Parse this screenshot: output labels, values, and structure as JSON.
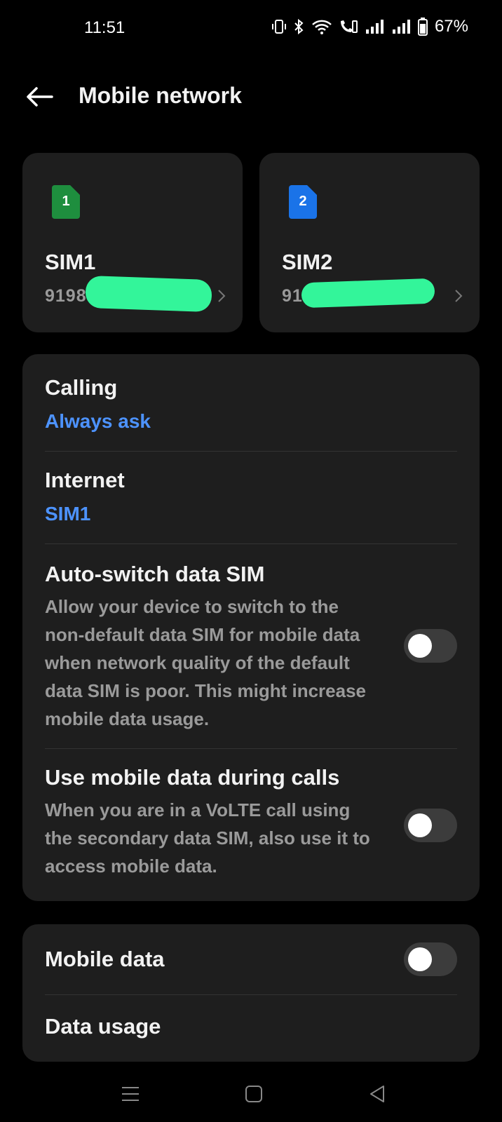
{
  "status_bar": {
    "time": "11:51",
    "battery": "67%"
  },
  "header": {
    "title": "Mobile network"
  },
  "sims": [
    {
      "badge": "1",
      "name": "SIM1",
      "number_visible": "9198",
      "color": "#1e8e3e"
    },
    {
      "badge": "2",
      "name": "SIM2",
      "number_visible": "91",
      "color": "#1a73e8"
    }
  ],
  "settings": {
    "calling": {
      "title": "Calling",
      "value": "Always ask"
    },
    "internet": {
      "title": "Internet",
      "value": "SIM1"
    },
    "auto_switch": {
      "title": "Auto-switch data SIM",
      "description": "Allow your device to switch to the non-default data SIM for mobile data when network quality of the default data SIM is poor. This might increase mobile data usage.",
      "enabled": false
    },
    "data_during_calls": {
      "title": "Use mobile data during calls",
      "description": "When you are in a VoLTE call using the secondary data SIM, also use it to access mobile data.",
      "enabled": false
    }
  },
  "data": {
    "mobile_data": {
      "title": "Mobile data",
      "enabled": false
    },
    "data_usage": {
      "title": "Data usage"
    }
  },
  "colors": {
    "background": "#000000",
    "card": "#1e1e1e",
    "accent": "#4d93ff",
    "redaction": "#33f59a"
  }
}
